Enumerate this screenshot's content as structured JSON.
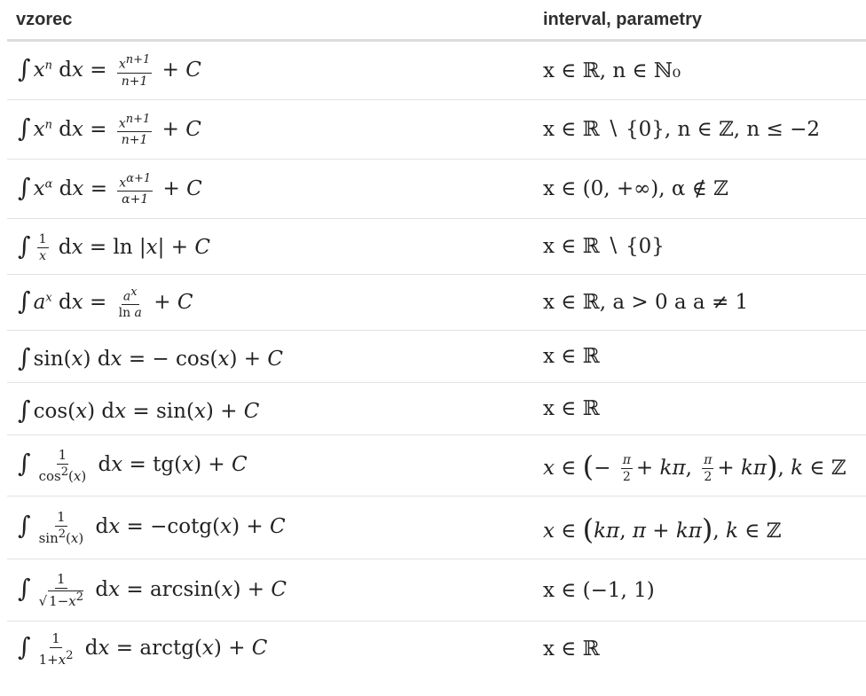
{
  "headers": {
    "formula": "vzorec",
    "interval": "interval, parametry"
  },
  "rows": [
    {
      "interval": "x ∈ ℝ, n ∈ ℕ₀"
    },
    {
      "interval": "x ∈ ℝ ∖ {0}, n ∈ ℤ, n ≤ −2"
    },
    {
      "interval": "x ∈ (0, +∞), α ∉ ℤ"
    },
    {
      "interval": "x ∈ ℝ ∖ {0}"
    },
    {
      "interval": "x ∈ ℝ, a > 0 a a ≠ 1"
    },
    {
      "interval": "x ∈ ℝ"
    },
    {
      "interval": "x ∈ ℝ"
    },
    {
      "interval": "x ∈ (− π/2 + kπ, π/2 + kπ), k ∈ ℤ"
    },
    {
      "interval": "x ∈ (kπ, π + kπ), k ∈ ℤ"
    },
    {
      "interval": "x ∈ (−1, 1)"
    },
    {
      "interval": "x ∈ ℝ"
    }
  ],
  "formulas": [
    "∫ xⁿ dx = xⁿ⁺¹/(n+1) + C",
    "∫ xⁿ dx = xⁿ⁺¹/(n+1) + C",
    "∫ x^α dx = x^(α+1)/(α+1) + C",
    "∫ 1/x dx = ln |x| + C",
    "∫ aˣ dx = aˣ/ln a + C",
    "∫ sin(x) dx = − cos(x) + C",
    "∫ cos(x) dx = sin(x) + C",
    "∫ 1/cos²(x) dx = tg(x) + C",
    "∫ 1/sin²(x) dx = −cotg(x) + C",
    "∫ 1/√(1−x²) dx = arcsin(x) + C",
    "∫ 1/(1+x²) dx = arctg(x) + C"
  ]
}
